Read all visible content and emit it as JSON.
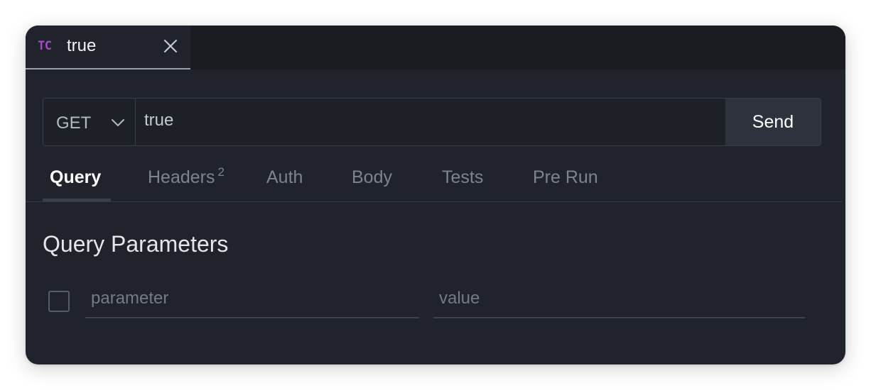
{
  "tab": {
    "badge": "TC",
    "title": "true",
    "close_icon": "close-icon"
  },
  "request": {
    "method": "GET",
    "url": "true",
    "send_label": "Send"
  },
  "subtabs": {
    "query": "Query",
    "headers": "Headers",
    "headers_count": "2",
    "auth": "Auth",
    "body": "Body",
    "tests": "Tests",
    "pre_run": "Pre Run"
  },
  "query_section": {
    "title": "Query Parameters",
    "parameter_placeholder": "parameter",
    "value_placeholder": "value"
  },
  "colors": {
    "background": "#20232b",
    "tabbar": "#1a1c22",
    "badge": "#a64bc4",
    "send_button": "#2e323c"
  }
}
